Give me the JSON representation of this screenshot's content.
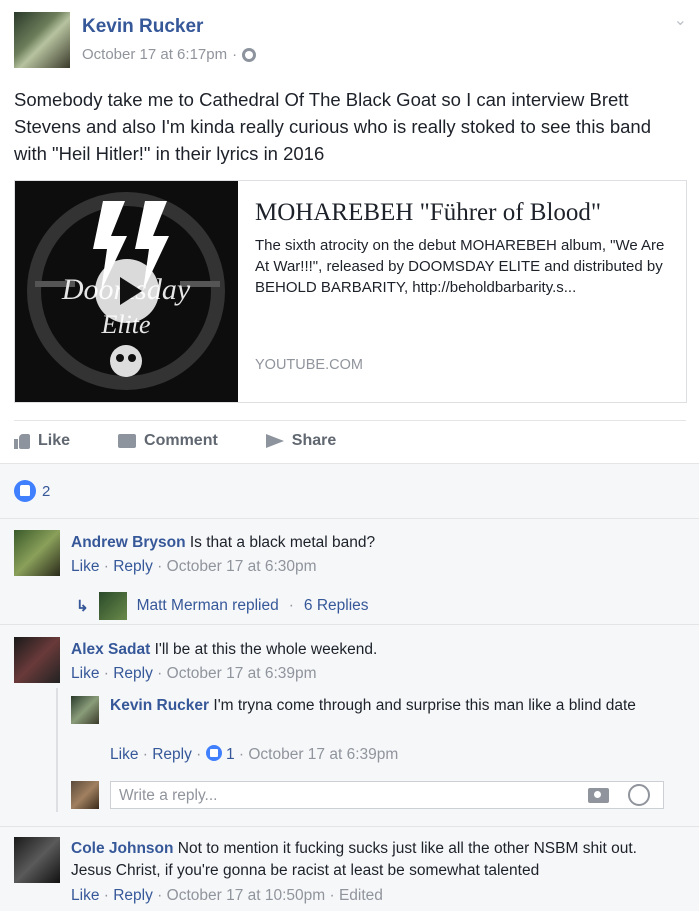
{
  "post": {
    "author": "Kevin Rucker",
    "timestamp": "October 17 at 6:17pm",
    "separator": "·",
    "text": "Somebody take me to Cathedral Of The Black Goat so I can interview Brett Stevens and also I'm kinda really curious who is really stoked to see this band with \"Heil Hitler!\" in their lyrics in 2016"
  },
  "preview": {
    "title": "MOHAREBEH \"Führer of Blood\"",
    "description": "The sixth atrocity on the debut MOHAREBEH album, \"We Are At War!!!\", released by DOOMSDAY ELITE and distributed by BEHOLD BARBARITY, http://beholdbarbarity.s...",
    "domain": "YOUTUBE.COM",
    "thumb_text_1": "Doomsday",
    "thumb_text_2": "Elite"
  },
  "actions": {
    "like": "Like",
    "comment": "Comment",
    "share": "Share"
  },
  "reactions": {
    "count": "2"
  },
  "comments": [
    {
      "name": "Andrew Bryson",
      "text": "Is that a black metal band?",
      "like": "Like",
      "reply": "Reply",
      "time": "October 17 at 6:30pm",
      "replies_summary": {
        "name": "Matt Merman replied",
        "count": "6 Replies"
      }
    },
    {
      "name": "Alex Sadat",
      "text": "I'll be at this the whole weekend.",
      "like": "Like",
      "reply": "Reply",
      "time": "October 17 at 6:39pm"
    },
    {
      "name": "Cole Johnson",
      "text": "Not to mention it fucking sucks just like all the other NSBM shit out. Jesus Christ, if you're gonna be racist at least be somewhat talented",
      "like": "Like",
      "reply": "Reply",
      "time": "October 17 at 10:50pm",
      "edited": "Edited"
    }
  ],
  "nested_reply": {
    "name": "Kevin Rucker",
    "text": "I'm tryna come through and surprise this man like a blind date",
    "like": "Like",
    "reply": "Reply",
    "likes": "1",
    "time": "October 17 at 6:39pm"
  },
  "reply_box": {
    "placeholder": "Write a reply..."
  },
  "colors": {
    "link": "#365899",
    "meta": "#90949c",
    "accent": "#4080ff"
  }
}
